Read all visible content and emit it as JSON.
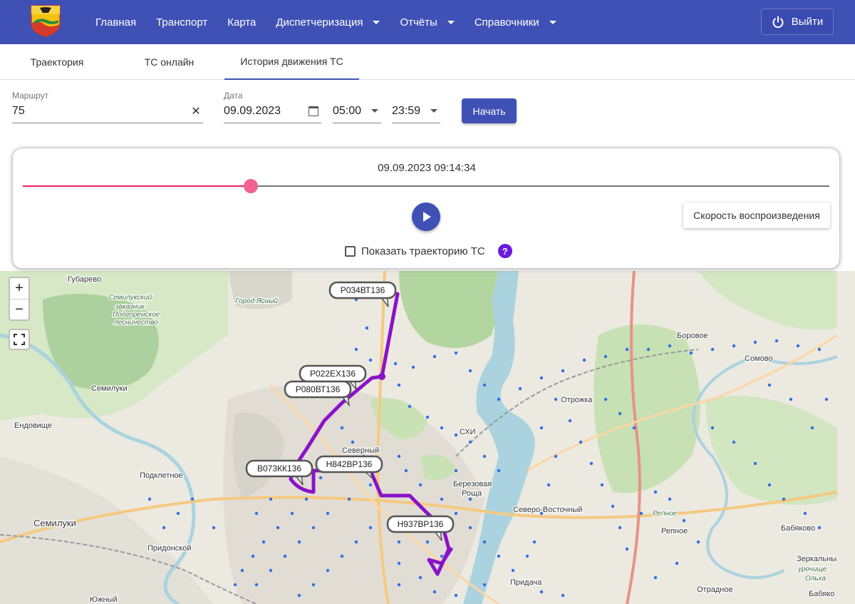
{
  "nav": {
    "items": [
      {
        "label": "Главная",
        "dropdown": false
      },
      {
        "label": "Транспорт",
        "dropdown": false
      },
      {
        "label": "Карта",
        "dropdown": false
      },
      {
        "label": "Диспетчеризация",
        "dropdown": true
      },
      {
        "label": "Отчёты",
        "dropdown": true
      },
      {
        "label": "Справочники",
        "dropdown": true
      }
    ],
    "logout_label": "Выйти"
  },
  "tabs": [
    {
      "label": "Траектория",
      "active": false
    },
    {
      "label": "ТС онлайн",
      "active": false
    },
    {
      "label": "История движения ТС",
      "active": true
    }
  ],
  "filters": {
    "route_label": "Маршрут",
    "route_value": "75",
    "date_label": "Дата",
    "date_value": "09.09.2023",
    "time_from": "05:00",
    "time_to": "23:59",
    "start_label": "Начать"
  },
  "player": {
    "timestamp": "09.09.2023 09:14:34",
    "progress": 0.283,
    "speed_label": "Скорость воспроизведения",
    "show_track_label": "Показать траекторию ТС",
    "show_track_checked": false,
    "help_glyph": "?"
  },
  "map": {
    "zoom_in": "+",
    "zoom_out": "−",
    "route_color": "#8a12c8",
    "places": [
      "Губарево",
      "Семилукский",
      "заказник",
      "Подгоренское",
      "лесничество",
      "Город Ясный",
      "Семилуки",
      "Ендовище",
      "Подклетное",
      "Семилуки",
      "Придонской",
      "Южный",
      "Северный",
      "Березовая",
      "Роща",
      "СХИ",
      "Отрожка",
      "Боровое",
      "Сомово",
      "Северо-Восточный",
      "Репное",
      "Репное",
      "Бабяково",
      "Зеркальны",
      "урочище",
      "Ольха",
      "Бабяко",
      "Отрадное",
      "Придача"
    ],
    "vehicles": [
      "Р034ВТ136",
      "Р022ЕХ136",
      "Р080ВТ136",
      "В073КК136",
      "Н842ВР136",
      "Н937ВР136"
    ]
  }
}
